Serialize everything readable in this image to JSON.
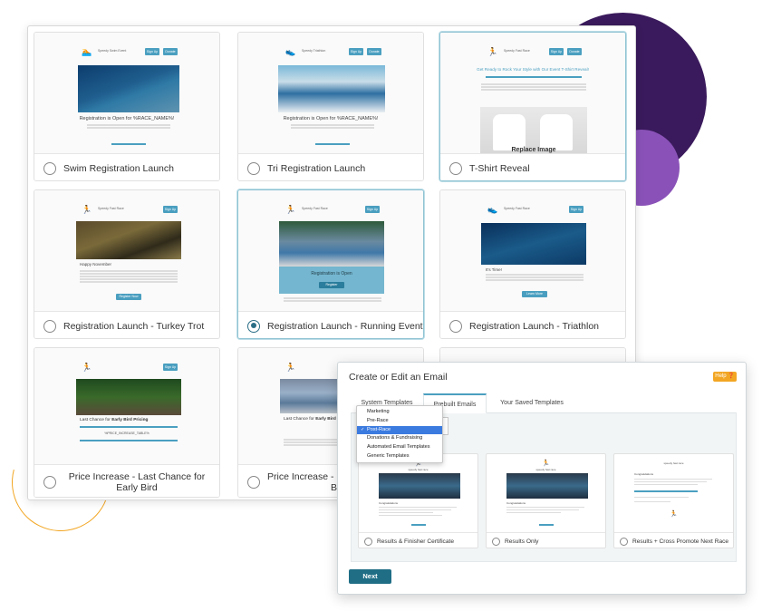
{
  "colors": {
    "accent_teal": "#4a9fc0",
    "deep_purple": "#3a1a5c",
    "light_purple": "#8a52b8",
    "orange": "#f2a623",
    "next_button": "#1f6e86",
    "selected_dropdown": "#3b7be0"
  },
  "templates": [
    {
      "label": "Swim Registration Launch",
      "selected": false,
      "preview": {
        "brand": "Speedy Swim Event",
        "title": "Registration is Open for %RACE_NAME%!",
        "buttons": [
          "Sign Up",
          "Donate"
        ]
      }
    },
    {
      "label": "Tri Registration Launch",
      "selected": false,
      "preview": {
        "brand": "Speedy Triathlon",
        "title": "Registration is Open for %RACE_NAME%!",
        "buttons": [
          "Sign Up",
          "Donate"
        ]
      }
    },
    {
      "label": "T-Shirt Reveal",
      "selected": false,
      "preview": {
        "brand": "Speedy Fast Race",
        "title": "Get Ready to Rock Your Style with Our Event T-Shirt Reveal!",
        "buttons": [
          "Sign Up",
          "Donate"
        ],
        "overlay": "Replace Image"
      }
    },
    {
      "label": "Registration Launch - Turkey Trot",
      "selected": false,
      "preview": {
        "brand": "Speedy Fast Race",
        "heading": "Happy November",
        "buttons": [
          "Sign Up"
        ],
        "cta": "Register Now"
      }
    },
    {
      "label": "Registration Launch - Running Event",
      "selected": true,
      "preview": {
        "brand": "Speedy Fast Race",
        "banner": "Registration is Open",
        "buttons": [
          "Sign Up"
        ],
        "cta": "Register"
      }
    },
    {
      "label": "Registration Launch - Triathlon",
      "selected": false,
      "preview": {
        "brand": "Speedy Fast Race",
        "heading": "It's Time!",
        "buttons": [
          "Sign Up"
        ],
        "cta": "Learn More"
      }
    },
    {
      "label": "Price Increase - Last Chance for Early Bird",
      "selected": false,
      "preview": {
        "title_plain": "Last Chance for ",
        "title_bold": "Early Bird Pricing",
        "code": "%PRICE_INCREASE_TABLE%",
        "buttons": [
          "Sign Up"
        ]
      }
    },
    {
      "label": "Price Increase - Last Chance for Early Bird",
      "label_visible_line1": "Price Increase - La",
      "label_visible_line2": "Bird",
      "selected": false,
      "preview": {
        "title_plain": "Last Chance for ",
        "title_bold": "Early Bird P"
      }
    }
  ],
  "dialog": {
    "title": "Create or Edit an Email",
    "help": "Help",
    "tabs": [
      {
        "label": "System Templates",
        "active": false
      },
      {
        "label": "Prebuilt Emails",
        "active": true
      },
      {
        "label": "Your Saved Templates",
        "active": false
      }
    ],
    "category_dropdown": {
      "options": [
        "Marketing",
        "Pre-Race",
        "Post-Race",
        "Donations & Fundraising",
        "Automated Email Templates",
        "Generic Templates"
      ],
      "selected": "Post-Race"
    },
    "prebuilt_templates": [
      {
        "label": "Results & Finisher Certificate",
        "brand": "speedy fast race",
        "greeting": "Congratulations"
      },
      {
        "label": "Results Only",
        "brand": "speedy fast race",
        "greeting": "Congratulations"
      },
      {
        "label": "Results + Cross Promote Next Race",
        "brand": "speedy fast race",
        "greeting": "Congratulations"
      }
    ],
    "next_label": "Next"
  }
}
